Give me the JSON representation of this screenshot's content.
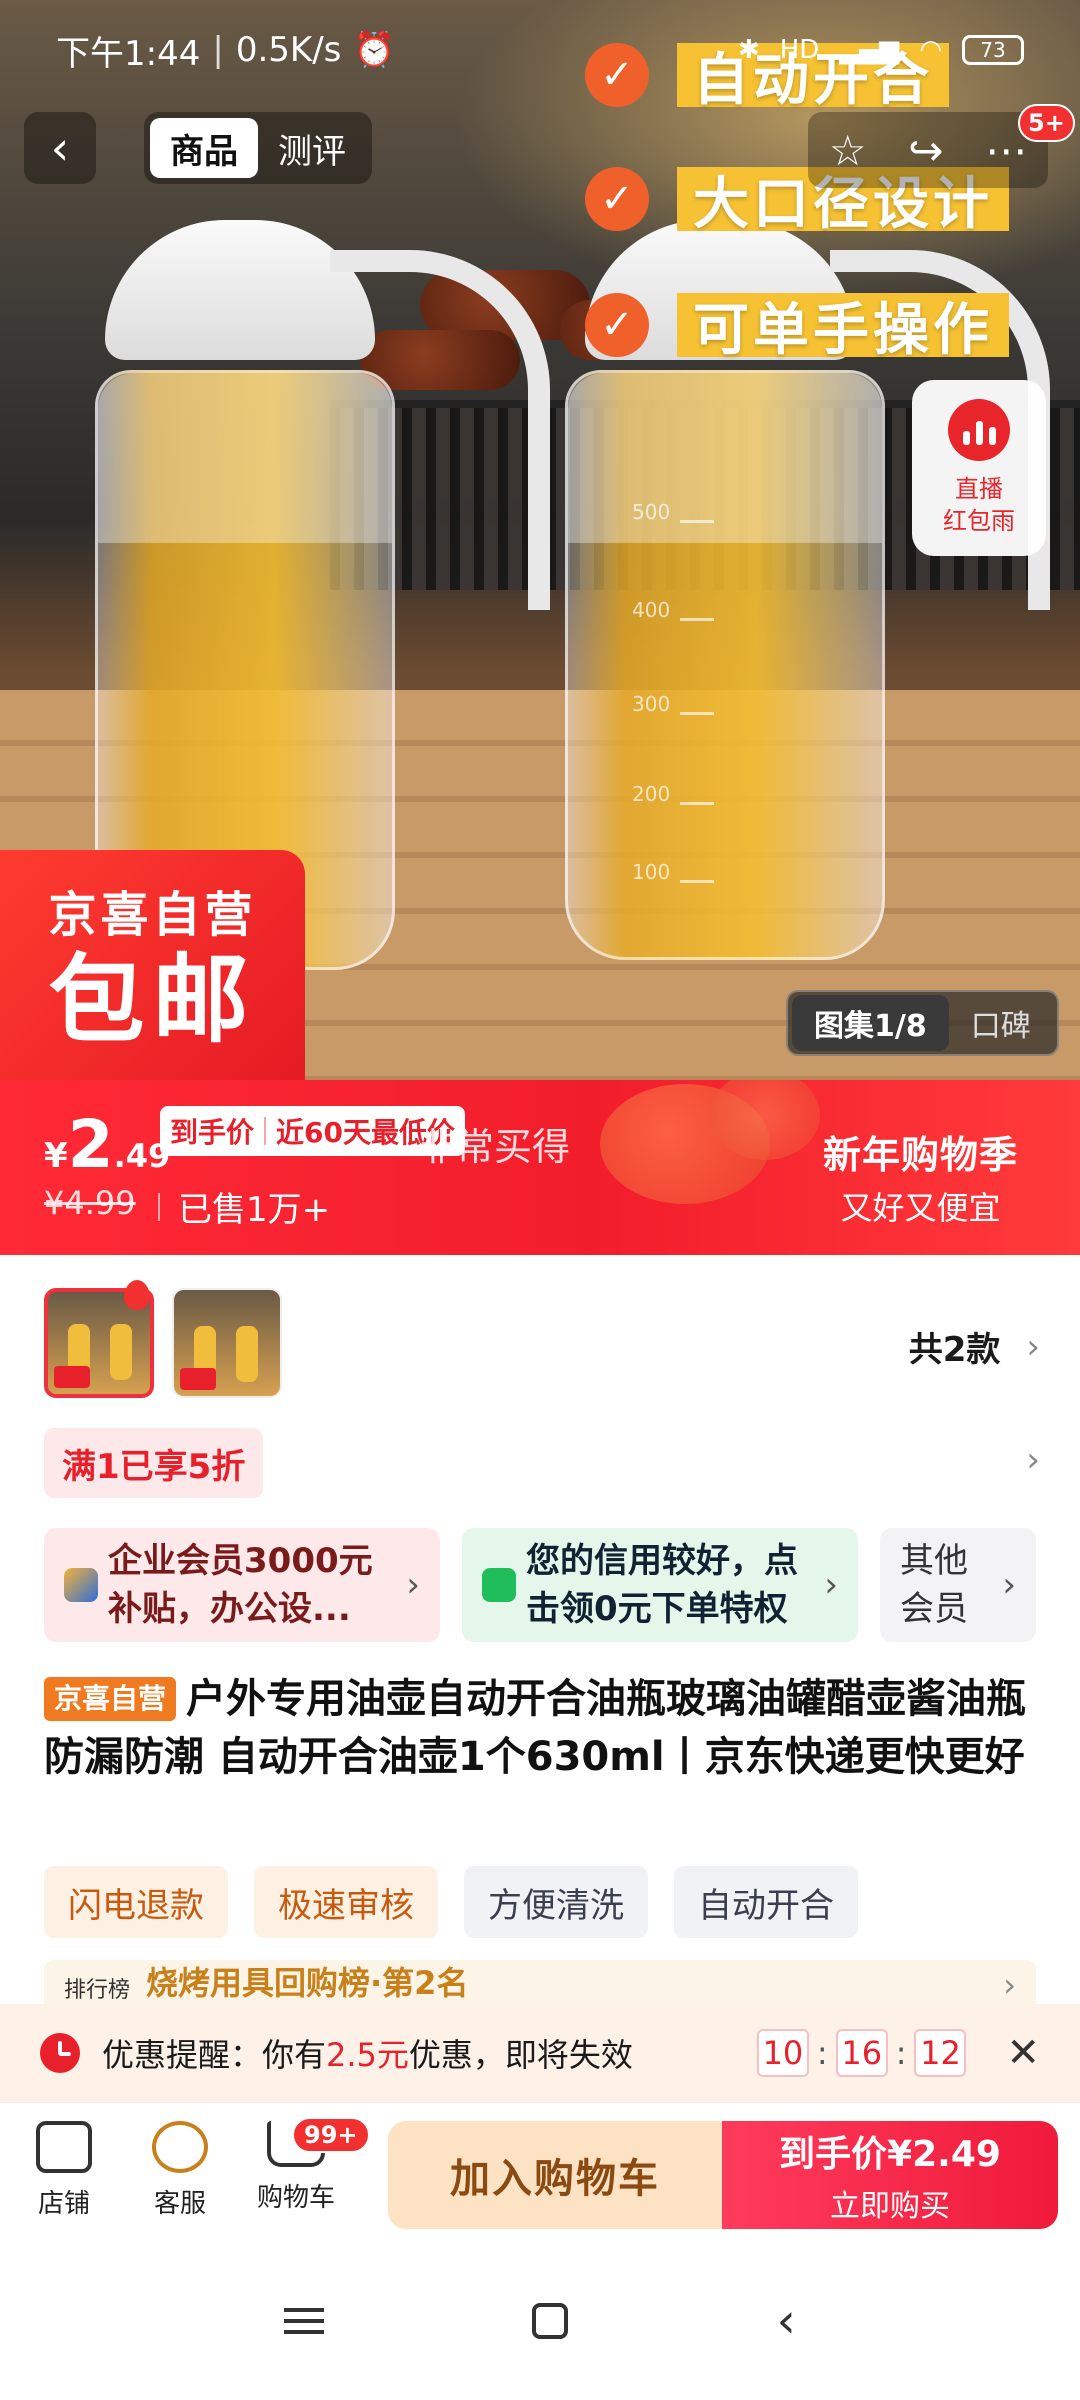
{
  "status": {
    "time": "下午1:44",
    "speed": "0.5K/s",
    "network": "HD",
    "battery": "73"
  },
  "nav": {
    "back_icon": "chevron-left-icon",
    "tabs": [
      "商品",
      "测评"
    ],
    "more_badge": "5+"
  },
  "hero": {
    "features": [
      "自动开合",
      "大口径设计",
      "可单手操作"
    ],
    "live": {
      "line1": "直播",
      "line2": "红包雨"
    },
    "promo_badge": {
      "line1": "京喜自营",
      "line2": "包邮"
    },
    "gallery": {
      "count_label": "图集1/8",
      "reviews_label": "口碑"
    },
    "scale_marks": [
      "500",
      "400",
      "300",
      "200",
      "100"
    ]
  },
  "price": {
    "currency": "¥",
    "integer": "2",
    "decimal": ".49",
    "tag_a": "到手价",
    "tag_b": "近60天最低价",
    "ghost": "非常买得",
    "original": "¥4.99",
    "sold": "已售1万+",
    "festival_title": "新年购物季",
    "festival_sub": "又好又便宜"
  },
  "variants": {
    "total": "共2款"
  },
  "discount": {
    "label": "满1已享5折"
  },
  "cards": {
    "enterprise": "企业会员3000元补贴，办公设...",
    "credit": "您的信用较好，点击领0元下单特权",
    "other": "其他会员"
  },
  "product": {
    "tag": "京喜自营",
    "title": "户外专用油壶自动开合油瓶玻璃油罐醋壶酱油瓶防漏防潮 自动开合油壶1个630ml丨京东快递更快更好"
  },
  "chips": [
    "闪电退款",
    "极速审核",
    "方便清洗",
    "自动开合"
  ],
  "rank": {
    "prefix": "排行榜",
    "text": "烧烤用具回购榜·第2名"
  },
  "reminder": {
    "prefix": "优惠提醒：你有",
    "amount": "2.5元",
    "suffix": "优惠，即将失效",
    "hh": "10",
    "mm": "16",
    "ss": "12"
  },
  "bottom": {
    "shop": "店铺",
    "service": "客服",
    "cart": "购物车",
    "cart_badge": "99+",
    "add_cart": "加入购物车",
    "buy_price_label": "到手价",
    "buy_price": "¥2.49",
    "buy_now": "立即购买"
  },
  "colors": {
    "brand_red": "#f21d2b",
    "accent_orange": "#f0602b",
    "feature_yellow": "#f6c233"
  }
}
